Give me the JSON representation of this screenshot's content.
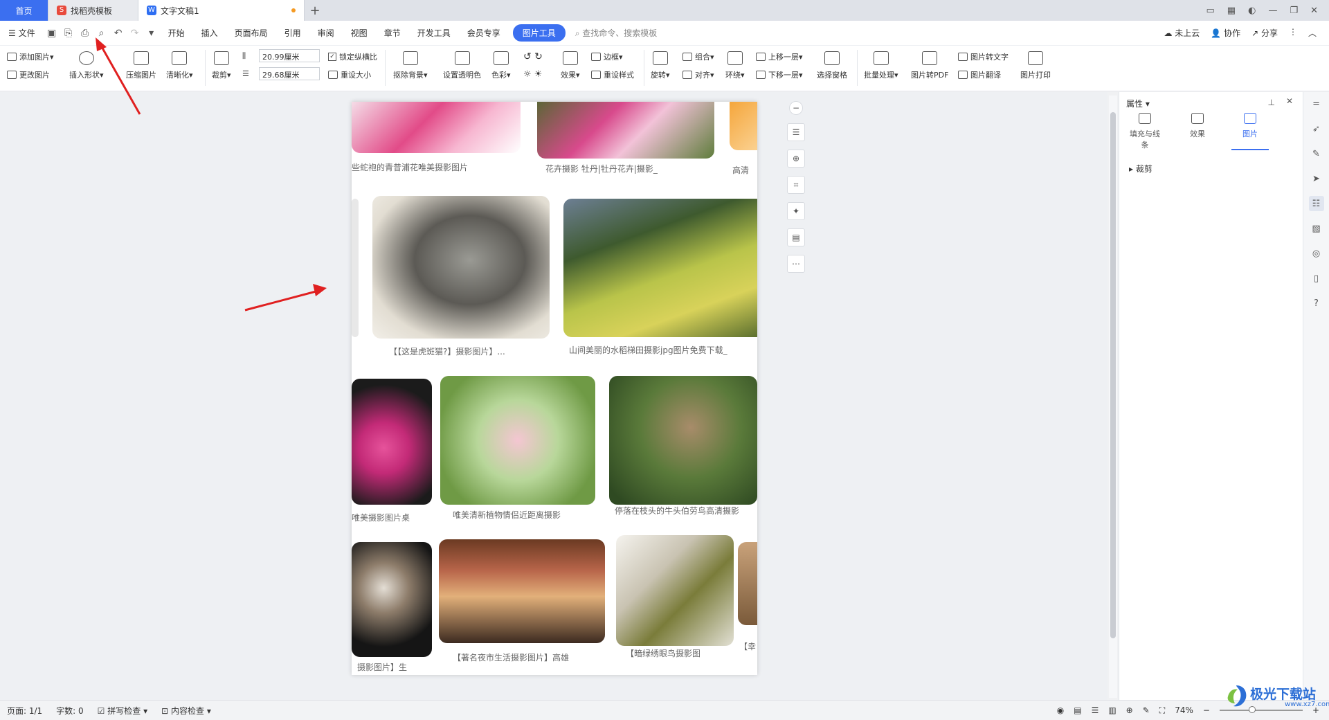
{
  "tabs": [
    {
      "label": "首页"
    },
    {
      "label": "找稻壳模板"
    },
    {
      "label": "文字文稿1"
    }
  ],
  "menu": {
    "file": "文件",
    "items": [
      "开始",
      "插入",
      "页面布局",
      "引用",
      "审阅",
      "视图",
      "章节",
      "开发工具",
      "会员专享"
    ],
    "active": "图片工具",
    "search": "查找命令、搜索模板",
    "right": [
      "未上云",
      "协作",
      "分享"
    ]
  },
  "ribbon": {
    "add_picture": "添加图片",
    "change_picture": "更改图片",
    "insert_shape": "插入形状",
    "compress": "压缩图片",
    "sharpen": "清晰化",
    "crop": "裁剪",
    "width": "20.99厘米",
    "height": "29.68厘米",
    "lock_ratio": "锁定纵横比",
    "reset_size": "重设大小",
    "remove_bg": "抠除背景",
    "transparency": "设置透明色",
    "color": "色彩",
    "effects": "效果",
    "border": "边框",
    "reset_style": "重设样式",
    "rotate": "旋转",
    "group": "组合",
    "align": "对齐",
    "wrap": "环绕",
    "bring_forward": "上移一层",
    "send_backward": "下移一层",
    "selection_pane": "选择窗格",
    "batch": "批量处理",
    "to_pdf": "图片转PDF",
    "to_text": "图片转文字",
    "translate": "图片翻译",
    "print": "图片打印"
  },
  "document": {
    "captions": {
      "r1a": "些蛇袍的青昔浦花唯美摄影图片",
      "r1b": "花卉摄影 牡丹|牡丹花卉|摄影_",
      "r1c": "高清",
      "r2a": "【【这是虎斑猫?】摄影图片】...",
      "r2b": "山间美丽的水稻梯田摄影jpg图片免费下载_",
      "r3a": "唯美摄影图片桌",
      "r3b": "唯美清新植物情侣近距离摄影",
      "r3c": "停落在枝头的牛头伯劳鸟高清摄影",
      "r4a": "摄影图片】生",
      "r4b": "【著名夜市生活摄影图片】高雄",
      "r4c": "【暗绿绣眼鸟摄影图",
      "r4d": "【幸"
    }
  },
  "panel": {
    "title": "属性",
    "tabs": [
      "填充与线条",
      "效果",
      "图片"
    ],
    "section": "裁剪"
  },
  "status": {
    "page": "页面: 1/1",
    "words": "字数: 0",
    "spell": "拼写检查",
    "content": "内容检查",
    "zoom": "74%"
  },
  "watermark": {
    "text": "极光下载站",
    "sub": "www.xz7.com"
  },
  "colors": {
    "accent": "#3b6ff0",
    "arrow": "#e02020"
  }
}
